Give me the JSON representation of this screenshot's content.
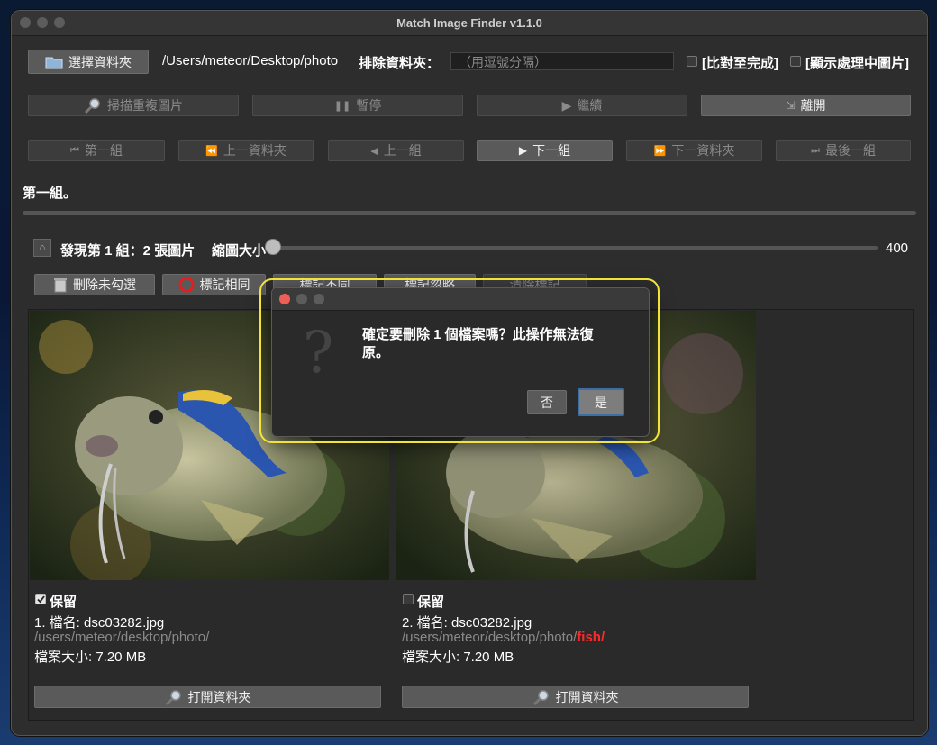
{
  "window": {
    "title": "Match Image Finder v1.1.0"
  },
  "top": {
    "select_folder": "選擇資料夾",
    "path": "/Users/meteor/Desktop/photo",
    "exclude_label": "排除資料夾：",
    "exclude_placeholder": "（用逗號分隔）",
    "compare_done": "[比對至完成]",
    "show_processing": "[顯示處理中圖片]"
  },
  "actions": {
    "scan": "掃描重複圖片",
    "pause": "暫停",
    "resume": "繼續",
    "exit": "離開"
  },
  "nav": {
    "first": "第一組",
    "prev_folder": "上一資料夾",
    "prev": "上一組",
    "next": "下一組",
    "next_folder": "下一資料夾",
    "last": "最後一組"
  },
  "status": {
    "text": "第一組。",
    "progress": 0.0
  },
  "group": {
    "found": "發現第 1 組：2 張圖片",
    "thumb_label": "縮圖大小",
    "thumb_value": "400"
  },
  "tools": {
    "delete_unchecked": "刪除未勾選",
    "mark_same": "標記相同",
    "t3": "標記不同",
    "t4": "標記忽略",
    "t5": "清除標記"
  },
  "cards": [
    {
      "keep_checked": true,
      "keep": "保留",
      "name": "1. 檔名: dsc03282.jpg",
      "path": "/users/meteor/desktop/photo/",
      "path_extra": "",
      "size": "檔案大小: 7.20 MB",
      "open": "打開資料夾"
    },
    {
      "keep_checked": false,
      "keep": "保留",
      "name": "2. 檔名: dsc03282.jpg",
      "path": "/users/meteor/desktop/photo/",
      "path_extra": "fish/",
      "size": "檔案大小: 7.20 MB",
      "open": "打開資料夾"
    }
  ],
  "dialog": {
    "message": "確定要刪除 1 個檔案嗎？此操作無法復原。",
    "no": "否",
    "yes": "是"
  },
  "colors": {
    "highlight": "#f2e33a",
    "path_extra": "#ff2a2a",
    "close": "#ec5f57"
  }
}
